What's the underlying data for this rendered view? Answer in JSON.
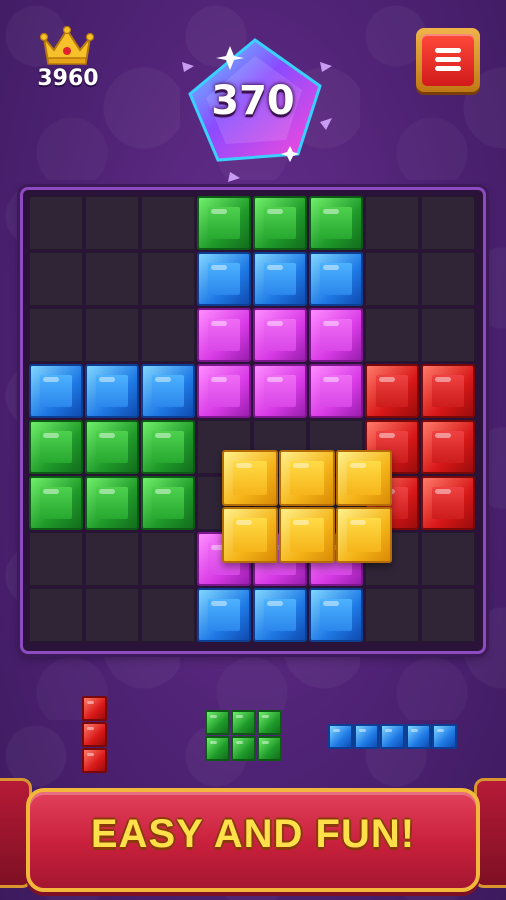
{
  "header": {
    "best_score": "3960",
    "score": "370"
  },
  "board": {
    "rows": 8,
    "cols": 8,
    "blocks": [
      {
        "row": 0,
        "col": 3,
        "color": "green"
      },
      {
        "row": 0,
        "col": 4,
        "color": "green"
      },
      {
        "row": 0,
        "col": 5,
        "color": "green"
      },
      {
        "row": 1,
        "col": 3,
        "color": "blue"
      },
      {
        "row": 1,
        "col": 4,
        "color": "blue"
      },
      {
        "row": 1,
        "col": 5,
        "color": "blue"
      },
      {
        "row": 2,
        "col": 3,
        "color": "purple"
      },
      {
        "row": 2,
        "col": 4,
        "color": "purple"
      },
      {
        "row": 2,
        "col": 5,
        "color": "purple"
      },
      {
        "row": 3,
        "col": 0,
        "color": "blue"
      },
      {
        "row": 3,
        "col": 1,
        "color": "blue"
      },
      {
        "row": 3,
        "col": 2,
        "color": "blue"
      },
      {
        "row": 3,
        "col": 3,
        "color": "purple"
      },
      {
        "row": 3,
        "col": 4,
        "color": "purple"
      },
      {
        "row": 3,
        "col": 5,
        "color": "purple"
      },
      {
        "row": 3,
        "col": 6,
        "color": "red"
      },
      {
        "row": 3,
        "col": 7,
        "color": "red"
      },
      {
        "row": 4,
        "col": 0,
        "color": "green"
      },
      {
        "row": 4,
        "col": 1,
        "color": "green"
      },
      {
        "row": 4,
        "col": 2,
        "color": "green"
      },
      {
        "row": 4,
        "col": 6,
        "color": "red"
      },
      {
        "row": 4,
        "col": 7,
        "color": "red"
      },
      {
        "row": 5,
        "col": 0,
        "color": "green"
      },
      {
        "row": 5,
        "col": 1,
        "color": "green"
      },
      {
        "row": 5,
        "col": 2,
        "color": "green"
      },
      {
        "row": 5,
        "col": 6,
        "color": "red"
      },
      {
        "row": 5,
        "col": 7,
        "color": "red"
      },
      {
        "row": 6,
        "col": 3,
        "color": "purple"
      },
      {
        "row": 6,
        "col": 4,
        "color": "purple"
      },
      {
        "row": 6,
        "col": 5,
        "color": "purple"
      },
      {
        "row": 7,
        "col": 3,
        "color": "blue"
      },
      {
        "row": 7,
        "col": 4,
        "color": "blue"
      },
      {
        "row": 7,
        "col": 5,
        "color": "blue"
      }
    ],
    "dragged_piece": {
      "color": "yellow",
      "rows": 2,
      "cols": 3
    }
  },
  "tray": [
    {
      "name": "piece-red-vertical-3",
      "color": "red",
      "rows": 3,
      "cols": 1
    },
    {
      "name": "piece-green-square-2x3",
      "color": "green",
      "rows": 2,
      "cols": 3
    },
    {
      "name": "piece-blue-horizontal-5",
      "color": "blue",
      "rows": 1,
      "cols": 5
    }
  ],
  "colors": {
    "green": "#2aa833",
    "blue": "#2b86ec",
    "purple": "#d947e8",
    "red": "#d81818",
    "yellow": "#f6b41a"
  },
  "banner": {
    "text": "EASY AND FUN!"
  }
}
